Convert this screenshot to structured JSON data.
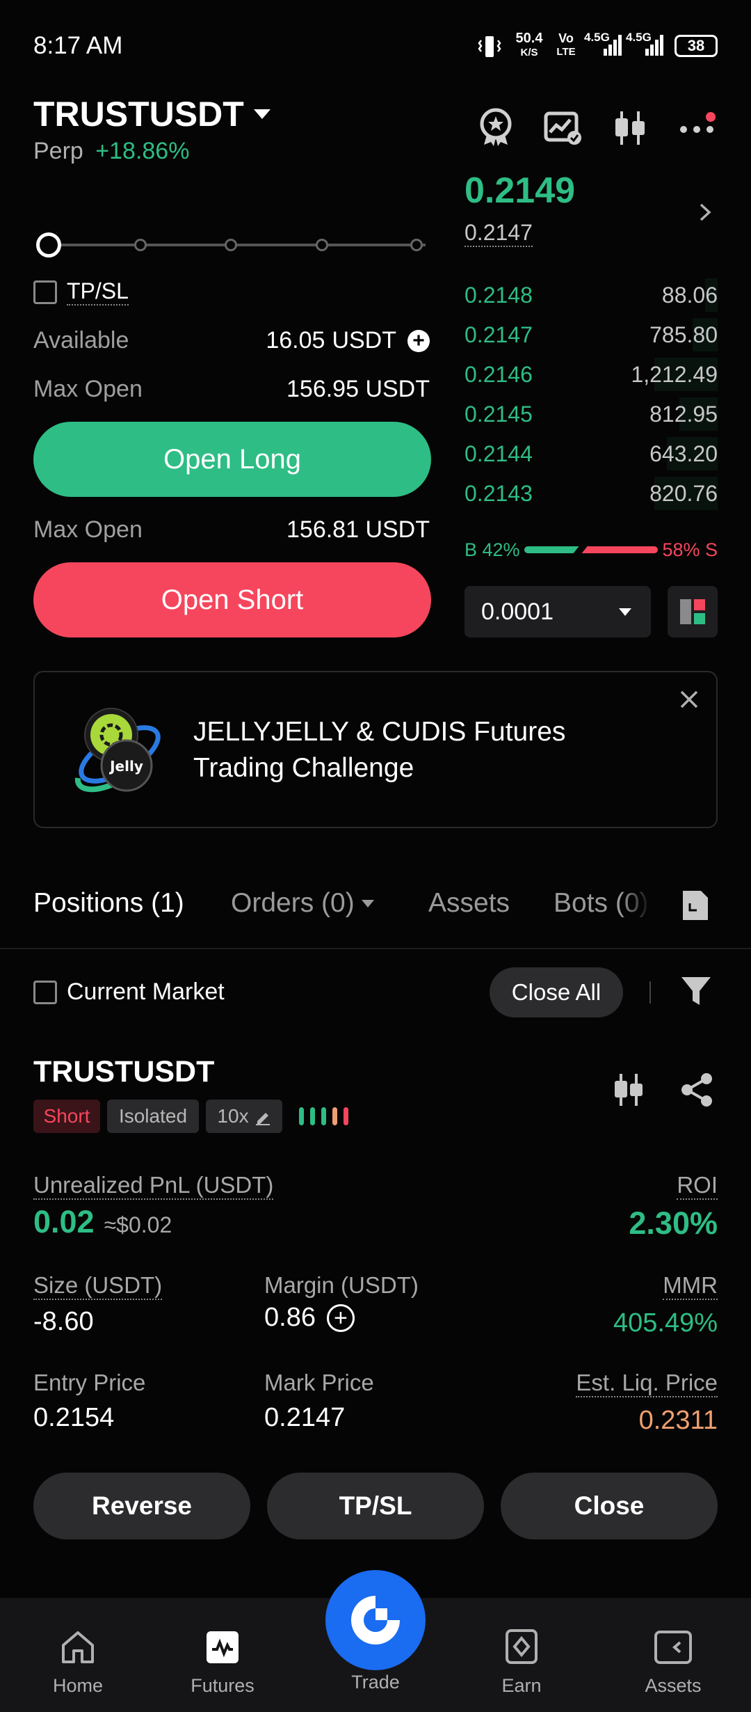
{
  "status_bar": {
    "time": "8:17 AM",
    "net_speed": "50.4",
    "net_unit": "K/S",
    "volte": "Vo",
    "volte_sub": "LTE",
    "sig1": "4.5G",
    "sig2": "4.5G",
    "battery": "38"
  },
  "header": {
    "symbol": "TRUSTUSDT",
    "contract_type": "Perp",
    "change_pct": "+18.86%"
  },
  "order_form": {
    "tpsl_label": "TP/SL",
    "available_label": "Available",
    "available_value": "16.05",
    "available_unit": "USDT",
    "max_open_label": "Max Open",
    "max_open_long_value": "156.95 USDT",
    "open_long_label": "Open Long",
    "max_open_short_value": "156.81 USDT",
    "open_short_label": "Open Short"
  },
  "orderbook": {
    "last_price": "0.2149",
    "mark_price": "0.2147",
    "rows": [
      {
        "price": "0.2148",
        "qty": "88.06",
        "depth": 0.05
      },
      {
        "price": "0.2147",
        "qty": "785.80",
        "depth": 0.1
      },
      {
        "price": "0.2146",
        "qty": "1,212.49",
        "depth": 0.25
      },
      {
        "price": "0.2145",
        "qty": "812.95",
        "depth": 0.15
      },
      {
        "price": "0.2144",
        "qty": "643.20",
        "depth": 0.2
      },
      {
        "price": "0.2143",
        "qty": "820.76",
        "depth": 0.25
      }
    ],
    "buy_label": "B 42%",
    "sell_label": "58% S",
    "buy_ratio": 0.42,
    "precision": "0.0001"
  },
  "banner": {
    "line1": "JELLYJELLY & CUDIS Futures",
    "line2": "Trading Challenge",
    "logo_text": "Jelly"
  },
  "tabs": {
    "positions": "Positions (1)",
    "orders": "Orders (0)",
    "assets": "Assets",
    "bots": "Bots (0)"
  },
  "filter_row": {
    "current_market": "Current Market",
    "close_all": "Close All"
  },
  "position": {
    "symbol": "TRUSTUSDT",
    "side": "Short",
    "margin_mode": "Isolated",
    "leverage": "10x",
    "unrealized_pnl_label": "Unrealized PnL (USDT)",
    "unrealized_pnl": "0.02",
    "unrealized_pnl_usd": "≈$0.02",
    "roi_label": "ROI",
    "roi": "2.30%",
    "size_label": "Size (USDT)",
    "size": "-8.60",
    "margin_label": "Margin (USDT)",
    "margin": "0.86",
    "mmr_label": "MMR",
    "mmr": "405.49%",
    "entry_label": "Entry Price",
    "entry": "0.2154",
    "mark_label": "Mark Price",
    "mark": "0.2147",
    "liq_label": "Est. Liq. Price",
    "liq": "0.2311",
    "reverse": "Reverse",
    "tpsl": "TP/SL",
    "close": "Close"
  },
  "bottom_nav": {
    "home": "Home",
    "futures": "Futures",
    "trade": "Trade",
    "earn": "Earn",
    "assets": "Assets"
  },
  "colors": {
    "green": "#2ebd85",
    "red": "#f6465d",
    "orange": "#f0a070",
    "blue": "#1a6cf0"
  }
}
